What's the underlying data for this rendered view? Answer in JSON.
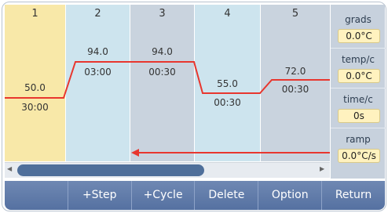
{
  "steps": [
    {
      "number": "1",
      "temp": "50.0",
      "time": "30:00",
      "bg": "#f8e8a8"
    },
    {
      "number": "2",
      "temp": "94.0",
      "time": "03:00",
      "bg": "#cde4ee"
    },
    {
      "number": "3",
      "temp": "94.0",
      "time": "00:30",
      "bg": "#c9d3de"
    },
    {
      "number": "4",
      "temp": "55.0",
      "time": "00:30",
      "bg": "#cde4ee"
    },
    {
      "number": "5",
      "temp": "72.0",
      "time": "00:30",
      "bg": "#c9d3de"
    }
  ],
  "params": [
    {
      "label": "grads",
      "value": "0.0°C"
    },
    {
      "label": "temp/c",
      "value": "0.0°C"
    },
    {
      "label": "time/c",
      "value": "0s"
    },
    {
      "label": "ramp",
      "value": "0.0°C/s"
    }
  ],
  "toolbar": {
    "empty_label": "",
    "step_label": "+Step",
    "cycle_label": "+Cycle",
    "delete_label": "Delete",
    "option_label": "Option",
    "return_label": "Return"
  },
  "colors": {
    "profile_line": "#e8362e",
    "cycle_arrow": "#e8362e",
    "toolbar": "#6079a8",
    "value_box": "#fff2bf"
  },
  "icons": {
    "scroll_left": "scroll-left-arrow-icon",
    "scroll_right": "scroll-right-arrow-icon"
  }
}
